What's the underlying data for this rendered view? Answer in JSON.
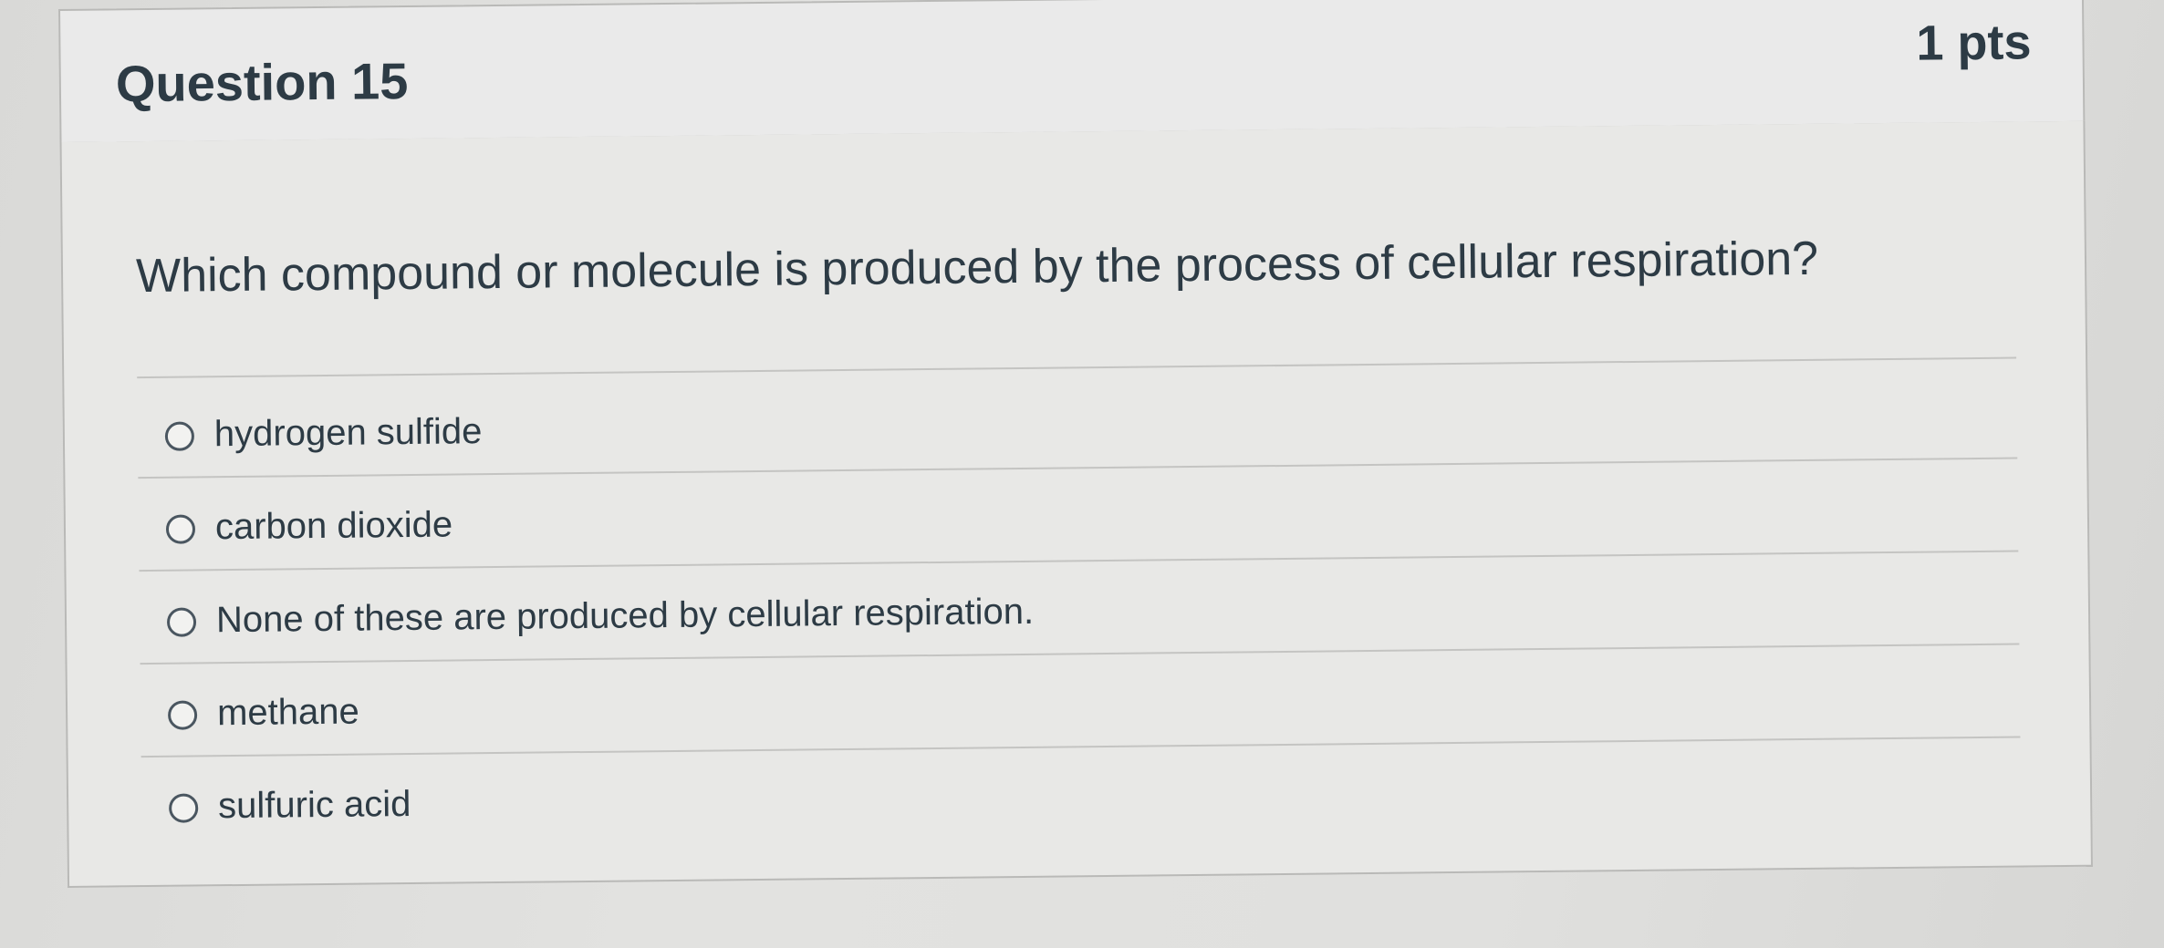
{
  "question": {
    "title": "Question 15",
    "points": "1 pts",
    "text": "Which compound or molecule is produced by the process of cellular respiration?"
  },
  "answers": [
    {
      "label": "hydrogen sulfide"
    },
    {
      "label": "carbon dioxide"
    },
    {
      "label": "None of these are produced by cellular respiration."
    },
    {
      "label": "methane"
    },
    {
      "label": "sulfuric acid"
    }
  ]
}
